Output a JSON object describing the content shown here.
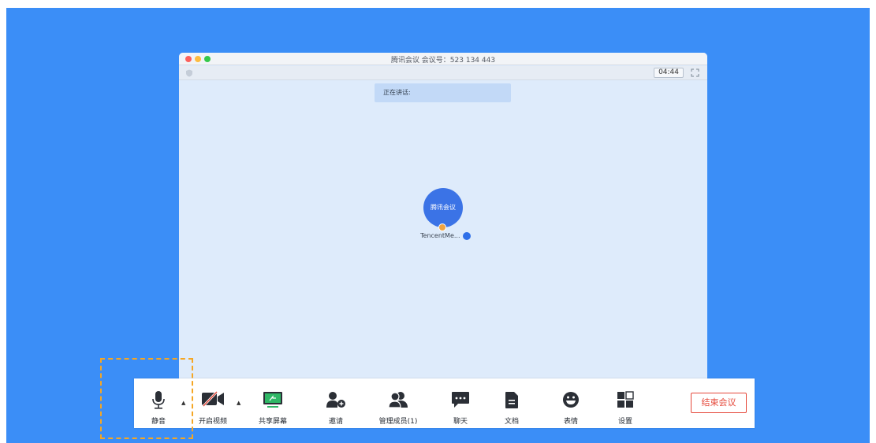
{
  "window": {
    "title": "腾讯会议 会议号：523 134 443",
    "timer": "04:44",
    "speaking_label": "正在讲话:",
    "avatar_text": "腾讯会议",
    "participant_name": "TencentMe..."
  },
  "toolbar": {
    "mute": "静音",
    "video": "开启视频",
    "share": "共享屏幕",
    "invite": "邀请",
    "members": "管理成员(1)",
    "chat": "聊天",
    "docs": "文档",
    "emoji": "表情",
    "settings": "设置",
    "end": "结束会议"
  },
  "colors": {
    "background": "#3b8ef7",
    "accent": "#3b73e6",
    "end_red": "#e5483a",
    "highlight": "#f5a623"
  }
}
